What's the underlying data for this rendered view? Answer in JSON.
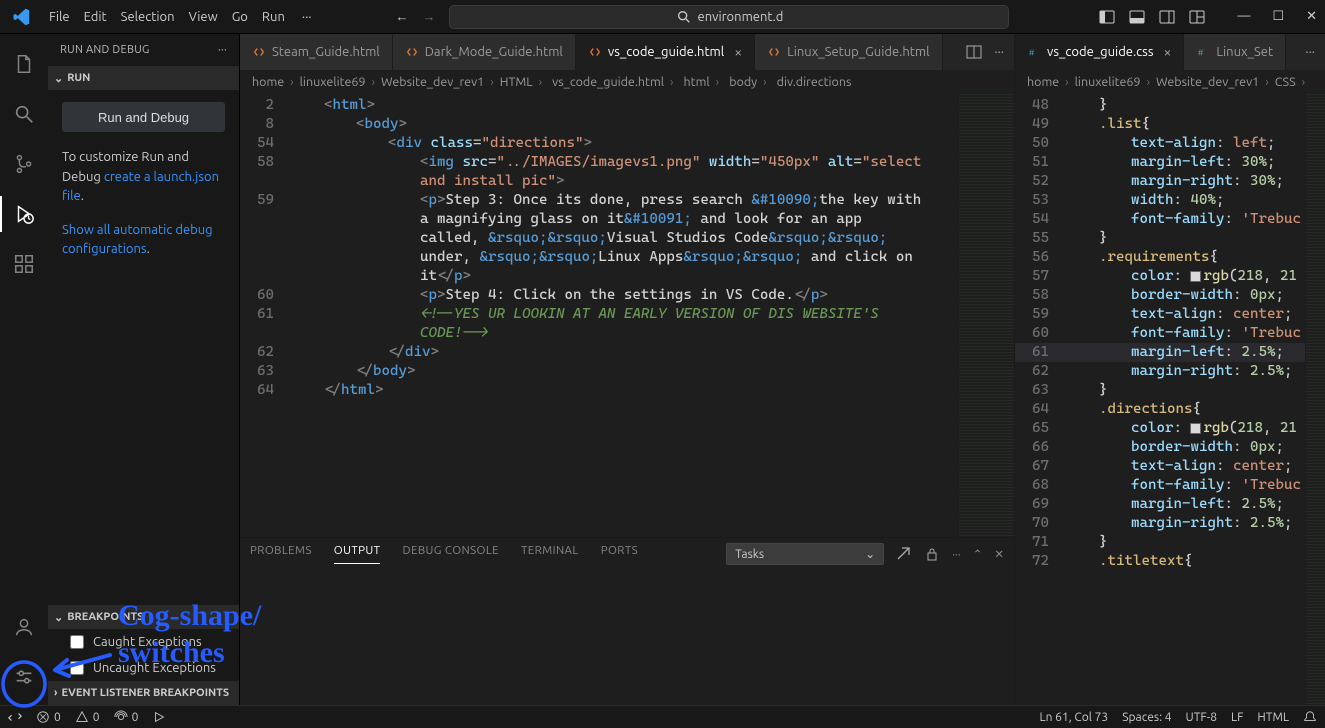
{
  "menu": {
    "items": [
      "File",
      "Edit",
      "Selection",
      "View",
      "Go",
      "Run"
    ],
    "more": "···"
  },
  "search_center": "environment.d",
  "layout_icons": [
    "panel-left",
    "panel-bottom",
    "panel-right",
    "layout-grid"
  ],
  "sidepanel": {
    "title": "RUN AND DEBUG",
    "run_section": "RUN",
    "run_button": "Run and Debug",
    "blurb_pre": "To customize Run and Debug ",
    "blurb_link1": "create a launch.json file",
    "blurb_mid": ".",
    "blurb2_pre": "Show all automatic debug configurations",
    "blurb2_mid": ".",
    "bp_head": "BREAKPOINTS",
    "bp1": "Caught Exceptions",
    "bp2": "Uncaught Exceptions",
    "elbp_head": "EVENT LISTENER BREAKPOINTS"
  },
  "tabs_left": [
    {
      "label": "Steam_Guide.html",
      "active": false,
      "close": false
    },
    {
      "label": "Dark_Mode_Guide.html",
      "active": false,
      "close": false
    },
    {
      "label": "vs_code_guide.html",
      "active": true,
      "close": true
    },
    {
      "label": "Linux_Setup_Guide.html",
      "active": false,
      "close": false
    }
  ],
  "tabs_right": [
    {
      "label": "vs_code_guide.css",
      "active": true,
      "close": true,
      "kind": "css"
    },
    {
      "label": "Linux_Set",
      "active": false,
      "close": false,
      "kind": "css"
    }
  ],
  "breadcrumb_left": [
    "home",
    "linuxelite69",
    "Website_dev_rev1",
    "HTML",
    "vs_code_guide.html",
    "html",
    "body",
    "div.directions"
  ],
  "breadcrumb_right": [
    "home",
    "linuxelite69",
    "Website_dev_rev1",
    "CSS"
  ],
  "panel": {
    "tabs": [
      "PROBLEMS",
      "OUTPUT",
      "DEBUG CONSOLE",
      "TERMINAL",
      "PORTS"
    ],
    "active": "OUTPUT",
    "select": "Tasks"
  },
  "status": {
    "remote": "",
    "errors": "0",
    "warnings": "0",
    "ports": "0",
    "ln": "Ln 61, Col 73",
    "spaces": "Spaces: 4",
    "enc": "UTF-8",
    "eol": "LF",
    "lang": "HTML"
  },
  "code_left": [
    {
      "n": "2",
      "html": "<span class='t-brk'>&lt;</span><span class='t-tag'>html</span><span class='t-brk'>&gt;</span>",
      "indent": 1
    },
    {
      "n": "8",
      "html": "<span class='t-brk'>&lt;</span><span class='t-tag'>body</span><span class='t-brk'>&gt;</span>",
      "indent": 2
    },
    {
      "n": "54",
      "html": "<span class='t-brk'>&lt;</span><span class='t-tag'>div</span> <span class='t-attr'>class</span>=<span class='t-str'>\"directions\"</span><span class='t-brk'>&gt;</span>",
      "indent": 3
    },
    {
      "n": "58",
      "html": "<span class='t-brk'>&lt;</span><span class='t-tag'>img</span> <span class='t-attr'>src</span>=<span class='t-str'>\"../IMAGES/imagevs1.png\"</span> <span class='t-attr'>width</span>=<span class='t-str'>\"450px\"</span> <span class='t-attr'>alt</span>=<span class='t-str'>\"select </span>",
      "indent": 4
    },
    {
      "n": "",
      "html": "<span class='t-str'>and install pic\"</span><span class='t-brk'>&gt;</span>",
      "indent": 4
    },
    {
      "n": "59",
      "html": "<span class='t-brk'>&lt;</span><span class='t-tag'>p</span><span class='t-brk'>&gt;</span><span class='t-txt'>Step 3: Once its done, press search </span><span class='t-ent'>&amp;#10090;</span><span class='t-txt'>the key with </span>",
      "indent": 4
    },
    {
      "n": "",
      "html": "<span class='t-txt'>a magnifying glass on it</span><span class='t-ent'>&amp;#10091;</span><span class='t-txt'> and look for an app </span>",
      "indent": 4
    },
    {
      "n": "",
      "html": "<span class='t-txt'>called, </span><span class='t-ent'>&amp;rsquo;&amp;rsquo;</span><span class='t-txt'>Visual Studios Code</span><span class='t-ent'>&amp;rsquo;&amp;rsquo;</span><span class='t-txt'> </span>",
      "indent": 4
    },
    {
      "n": "",
      "html": "<span class='t-txt'>under, </span><span class='t-ent'>&amp;rsquo;&amp;rsquo;</span><span class='t-txt'>Linux Apps</span><span class='t-ent'>&amp;rsquo;&amp;rsquo;</span><span class='t-txt'> and click on </span>",
      "indent": 4
    },
    {
      "n": "",
      "html": "<span class='t-txt'>it</span><span class='t-brk'>&lt;/</span><span class='t-tag'>p</span><span class='t-brk'>&gt;</span>",
      "indent": 4
    },
    {
      "n": "60",
      "html": "<span class='t-brk'>&lt;</span><span class='t-tag'>p</span><span class='t-brk'>&gt;</span><span class='t-txt'>Step 4: Click on the settings in VS Code.</span><span class='t-brk'>&lt;/</span><span class='t-tag'>p</span><span class='t-brk'>&gt;</span>",
      "indent": 4
    },
    {
      "n": "61",
      "html": "<span class='t-cmt'>&lt;!--YES UR LOOKIN AT AN EARLY VERSION OF DIS WEBSITE'S </span>",
      "indent": 4
    },
    {
      "n": "",
      "html": "<span class='t-cmt'>CODE!--&gt;</span>",
      "indent": 4
    },
    {
      "n": "62",
      "html": "<span class='t-brk'>&lt;/</span><span class='t-tag'>div</span><span class='t-brk'>&gt;</span>",
      "indent": 3
    },
    {
      "n": "63",
      "html": "<span class='t-brk'>&lt;/</span><span class='t-tag'>body</span><span class='t-brk'>&gt;</span>",
      "indent": 2
    },
    {
      "n": "64",
      "html": "<span class='t-brk'>&lt;/</span><span class='t-tag'>html</span><span class='t-brk'>&gt;</span>",
      "indent": 1
    }
  ],
  "code_right": [
    {
      "n": "48",
      "html": "<span class='t-brace'>}</span>",
      "indent": 1
    },
    {
      "n": "49",
      "html": "<span class='t-sel'>.list</span><span class='t-brace'>{</span>",
      "indent": 1
    },
    {
      "n": "50",
      "html": "<span class='t-prop'>text-align</span>: <span class='t-val'>left</span>;",
      "indent": 2
    },
    {
      "n": "51",
      "html": "<span class='t-prop'>margin-left</span>: <span class='t-num'>30%</span>;",
      "indent": 2
    },
    {
      "n": "52",
      "html": "<span class='t-prop'>margin-right</span>: <span class='t-num'>30%</span>;",
      "indent": 2
    },
    {
      "n": "53",
      "html": "<span class='t-prop'>width</span>: <span class='t-num'>40%</span>;",
      "indent": 2
    },
    {
      "n": "54",
      "html": "<span class='t-prop'>font-family</span>: <span class='t-val'>'Trebuc</span>",
      "indent": 2
    },
    {
      "n": "55",
      "html": "<span class='t-brace'>}</span>",
      "indent": 1
    },
    {
      "n": "56",
      "html": "<span class='t-sel'>.requirements</span><span class='t-brace'>{</span>",
      "indent": 1
    },
    {
      "n": "57",
      "html": "<span class='t-prop'>color</span>: <span class='color-swatch'></span><span class='t-fn'>rgb</span>(<span class='t-num'>218</span>, <span class='t-num'>21</span>",
      "indent": 2
    },
    {
      "n": "58",
      "html": "<span class='t-prop'>border-width</span>: <span class='t-num'>0px</span>;",
      "indent": 2
    },
    {
      "n": "59",
      "html": "<span class='t-prop'>text-align</span>: <span class='t-val'>center</span>;",
      "indent": 2
    },
    {
      "n": "60",
      "html": "<span class='t-prop'>font-family</span>: <span class='t-val'>'Trebuc</span>",
      "indent": 2
    },
    {
      "n": "61",
      "html": "<span class='t-prop'>margin-left</span>: <span class='t-num'>2.5%</span>;",
      "indent": 2,
      "hl": true
    },
    {
      "n": "62",
      "html": "<span class='t-prop'>margin-right</span>: <span class='t-num'>2.5%</span>;",
      "indent": 2
    },
    {
      "n": "63",
      "html": "<span class='t-brace'>}</span>",
      "indent": 1
    },
    {
      "n": "64",
      "html": "<span class='t-sel'>.directions</span><span class='t-brace'>{</span>",
      "indent": 1
    },
    {
      "n": "65",
      "html": "<span class='t-prop'>color</span>: <span class='color-swatch'></span><span class='t-fn'>rgb</span>(<span class='t-num'>218</span>, <span class='t-num'>21</span>",
      "indent": 2
    },
    {
      "n": "66",
      "html": "<span class='t-prop'>border-width</span>: <span class='t-num'>0px</span>;",
      "indent": 2
    },
    {
      "n": "67",
      "html": "<span class='t-prop'>text-align</span>: <span class='t-val'>center</span>;",
      "indent": 2
    },
    {
      "n": "68",
      "html": "<span class='t-prop'>font-family</span>: <span class='t-val'>'Trebuc</span>",
      "indent": 2
    },
    {
      "n": "69",
      "html": "<span class='t-prop'>margin-left</span>: <span class='t-num'>2.5%</span>;",
      "indent": 2
    },
    {
      "n": "70",
      "html": "<span class='t-prop'>margin-right</span>: <span class='t-num'>2.5%</span>;",
      "indent": 2
    },
    {
      "n": "71",
      "html": "<span class='t-brace'>}</span>",
      "indent": 1
    },
    {
      "n": "72",
      "html": "<span class='t-sel'>.titletext</span><span class='t-brace'>{</span>",
      "indent": 1
    }
  ],
  "annotation": "Cog-shape/\nswitches"
}
